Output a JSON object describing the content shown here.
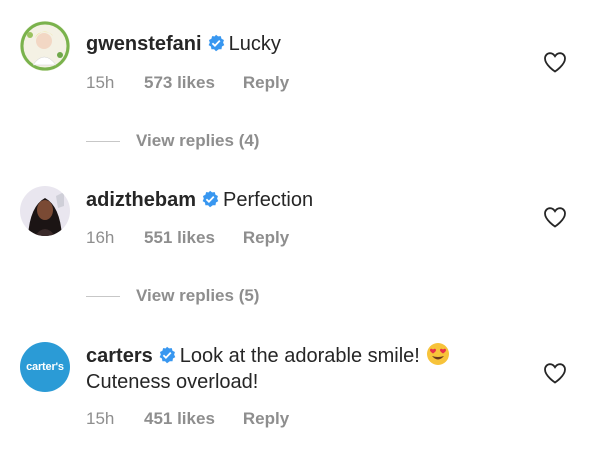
{
  "comments": [
    {
      "username": "gwenstefani",
      "text": "Lucky",
      "time": "15h",
      "likes": "573 likes",
      "reply": "Reply",
      "view_replies": "View replies (4)",
      "verified": true
    },
    {
      "username": "adizthebam",
      "text": "Perfection",
      "time": "16h",
      "likes": "551 likes",
      "reply": "Reply",
      "view_replies": "View replies (5)",
      "verified": true
    },
    {
      "username": "carters",
      "text": "Look at the adorable smile!",
      "text_line2": "Cuteness overload!",
      "avatar_text": "carter's",
      "time": "15h",
      "likes": "451 likes",
      "reply": "Reply",
      "verified": true,
      "emoji": "heart-eyes-emoji"
    }
  ],
  "colors": {
    "text": "#262626",
    "secondary": "#8e8e8e",
    "verified": "#3897f0",
    "carters_brand": "#2b9bd6"
  },
  "icons": [
    "verified-badge-icon",
    "heart-outline-icon",
    "heart-eyes-emoji"
  ]
}
